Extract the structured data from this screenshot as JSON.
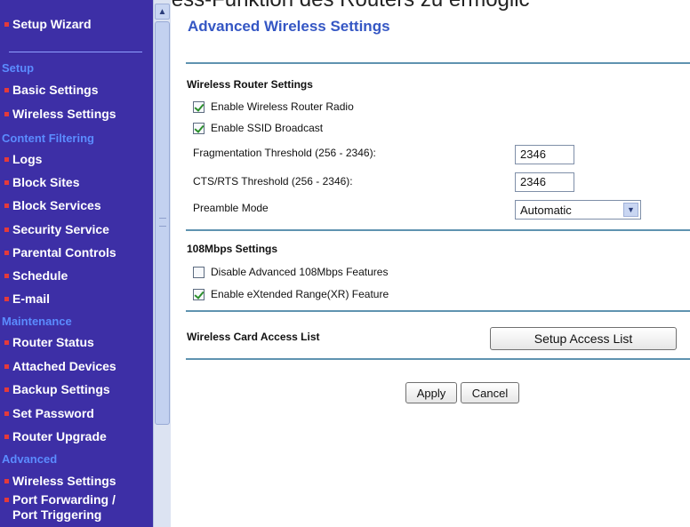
{
  "caption": "sein, um die Wireless-Funktion des Routers zu ermöglic",
  "sidebar": {
    "top_item": "Setup Wizard",
    "sections": {
      "setup": "Setup",
      "content_filtering": "Content Filtering",
      "maintenance": "Maintenance",
      "advanced": "Advanced"
    },
    "items": {
      "basic_settings": "Basic Settings",
      "wireless_settings": "Wireless Settings",
      "logs": "Logs",
      "block_sites": "Block Sites",
      "block_services": "Block Services",
      "security_service": "Security Service",
      "parental_controls": "Parental Controls",
      "schedule": "Schedule",
      "email": "E-mail",
      "router_status": "Router Status",
      "attached_devices": "Attached Devices",
      "backup_settings": "Backup Settings",
      "set_password": "Set Password",
      "router_upgrade": "Router Upgrade",
      "adv_wireless_settings": "Wireless Settings",
      "port_forwarding_1": "Port Forwarding /",
      "port_forwarding_2": "Port Triggering"
    }
  },
  "main": {
    "title": "Advanced Wireless Settings",
    "router_section": {
      "title": "Wireless Router Settings",
      "enable_radio": {
        "label": "Enable Wireless Router Radio",
        "checked": true
      },
      "enable_ssid": {
        "label": "Enable SSID Broadcast",
        "checked": true
      },
      "frag_label": "Fragmentation Threshold (256 - 2346):",
      "frag_value": "2346",
      "cts_label": "CTS/RTS Threshold (256 - 2346):",
      "cts_value": "2346",
      "preamble_label": "Preamble Mode",
      "preamble_value": "Automatic"
    },
    "mbps_section": {
      "title": "108Mbps Settings",
      "disable_advanced": {
        "label": "Disable Advanced 108Mbps Features",
        "checked": false
      },
      "enable_xr": {
        "label": "Enable eXtended Range(XR) Feature",
        "checked": true
      }
    },
    "access_list": {
      "label": "Wireless Card Access List",
      "button": "Setup Access List"
    },
    "buttons": {
      "apply": "Apply",
      "cancel": "Cancel"
    }
  },
  "colors": {
    "sidebar_bg": "#3d2fa6",
    "sidebar_heading": "#5b8cff",
    "bullet": "#e43a3a",
    "title": "#3557c4",
    "rule": "#5f93b0"
  },
  "icons": {
    "scroll_up": "chevron-up-icon",
    "select_arrow": "chevron-down-icon",
    "bullet": "square-bullet-icon"
  }
}
